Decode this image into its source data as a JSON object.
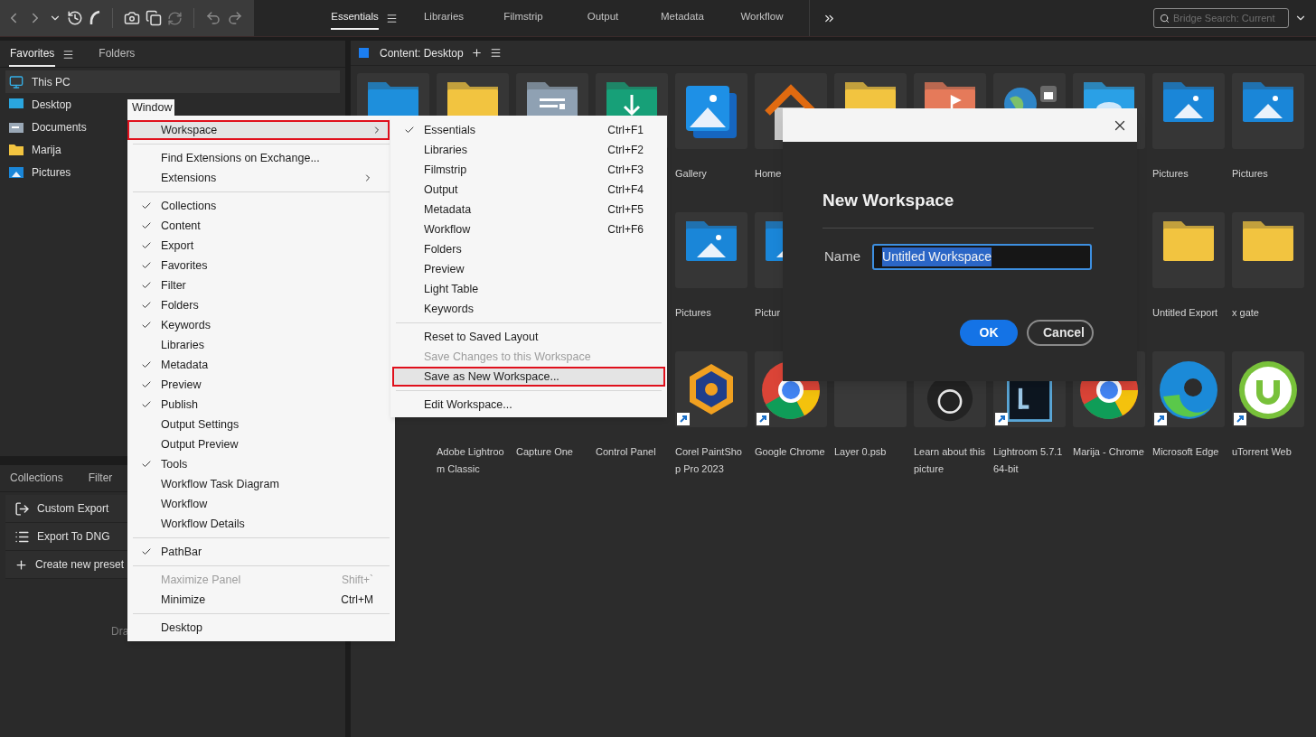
{
  "toolbar": {
    "search": {
      "placeholder": "Bridge Search: Current"
    }
  },
  "workspace_tabs": [
    {
      "label": "Essentials",
      "selected": true,
      "has_menu": true
    },
    {
      "label": "Libraries",
      "selected": false
    },
    {
      "label": "Filmstrip",
      "selected": false
    },
    {
      "label": "Output",
      "selected": false
    },
    {
      "label": "Metadata",
      "selected": false
    },
    {
      "label": "Workflow",
      "selected": false
    }
  ],
  "favorites_panel": {
    "tabs": [
      {
        "label": "Favorites",
        "selected": true,
        "has_menu": true
      },
      {
        "label": "Folders",
        "selected": false
      }
    ],
    "items": [
      {
        "label": "This PC",
        "kind": "pc",
        "selected": true
      },
      {
        "label": "Desktop",
        "kind": "desktop",
        "selected": false
      },
      {
        "label": "Documents",
        "kind": "documents",
        "selected": false
      },
      {
        "label": "Marija",
        "kind": "user-folder",
        "selected": false
      },
      {
        "label": "Pictures",
        "kind": "pictures",
        "selected": false
      }
    ]
  },
  "collections_panel": {
    "tabs": [
      {
        "label": "Collections",
        "selected": false
      },
      {
        "label": "Filter",
        "selected": false
      }
    ],
    "items": [
      {
        "label": "Custom Export",
        "kind": "export"
      },
      {
        "label": "Export To DNG",
        "kind": "list"
      },
      {
        "label": "Create new preset",
        "kind": "add"
      }
    ],
    "hint": "Dra"
  },
  "content": {
    "title": "Content: Desktop",
    "rows": [
      [
        {
          "kind": "folder",
          "color": "#1e8fdc"
        },
        {
          "kind": "folder",
          "color": "#f2c440"
        },
        {
          "kind": "documents-folder",
          "color": "#8fa1b3"
        },
        {
          "kind": "downloads-folder",
          "color": "#17a078"
        },
        {
          "kind": "gallery",
          "label": "Gallery"
        },
        {
          "kind": "home",
          "label": "Home"
        },
        {
          "kind": "folder",
          "color": "#f2c440"
        },
        {
          "kind": "music-folder",
          "color": "#e57a5a"
        },
        {
          "kind": "network"
        },
        {
          "kind": "cloud-folder",
          "color": "#2aa0e6"
        },
        {
          "kind": "pictures-folder",
          "label": "Pictures"
        },
        {
          "kind": "pictures-folder",
          "label": "Pictures"
        }
      ],
      [
        {
          "kind": "covered"
        },
        {
          "kind": "covered"
        },
        {
          "kind": "covered"
        },
        {
          "kind": "covered"
        },
        {
          "kind": "pictures-folder",
          "label": "Pictures"
        },
        {
          "kind": "pictures-folder",
          "label": "Pictur"
        },
        {
          "kind": "covered"
        },
        {
          "kind": "covered"
        },
        {
          "kind": "covered"
        },
        {
          "kind": "covered"
        },
        {
          "kind": "folder",
          "color": "#f2c440",
          "label": "Untitled Export"
        },
        {
          "kind": "folder",
          "color": "#f2c440",
          "label": "x gate"
        }
      ],
      [
        {
          "kind": "covered"
        },
        {
          "kind": "covered",
          "label": "Adobe Lightroom Classic"
        },
        {
          "kind": "covered",
          "label": "Capture One"
        },
        {
          "kind": "covered",
          "label": "Control Panel"
        },
        {
          "kind": "paint-app",
          "label": "Corel PaintShop Pro 2023",
          "shortcut": true
        },
        {
          "kind": "browser",
          "label": "Google Chrome",
          "shortcut": true
        },
        {
          "kind": "blank",
          "label": "Layer 0.psb"
        },
        {
          "kind": "dark-circle",
          "label": "Learn about this picture"
        },
        {
          "kind": "photo-app",
          "label": "Lightroom 5.7.1 64-bit",
          "shortcut": true
        },
        {
          "kind": "browser",
          "label": "Marija - Chrome"
        },
        {
          "kind": "edge-browser",
          "label": "Microsoft Edge",
          "shortcut": true
        },
        {
          "kind": "torrent-app",
          "label": "uTorrent Web",
          "shortcut": true
        }
      ]
    ]
  },
  "window_menu": {
    "title": "Window",
    "items": [
      {
        "kind": "item",
        "label": "Workspace",
        "submenu": true,
        "highlighted": true,
        "checked": false,
        "disabled": false
      },
      {
        "kind": "separator"
      },
      {
        "kind": "item",
        "label": "Find Extensions on Exchange...",
        "checked": false,
        "disabled": false
      },
      {
        "kind": "item",
        "label": "Extensions",
        "submenu": true,
        "checked": false,
        "disabled": false
      },
      {
        "kind": "separator"
      },
      {
        "kind": "item",
        "label": "Collections",
        "checked": true,
        "disabled": false
      },
      {
        "kind": "item",
        "label": "Content",
        "checked": true,
        "disabled": false
      },
      {
        "kind": "item",
        "label": "Export",
        "checked": true,
        "disabled": false
      },
      {
        "kind": "item",
        "label": "Favorites",
        "checked": true,
        "disabled": false
      },
      {
        "kind": "item",
        "label": "Filter",
        "checked": true,
        "disabled": false
      },
      {
        "kind": "item",
        "label": "Folders",
        "checked": true,
        "disabled": false
      },
      {
        "kind": "item",
        "label": "Keywords",
        "checked": true,
        "disabled": false
      },
      {
        "kind": "item",
        "label": "Libraries",
        "checked": false,
        "disabled": false
      },
      {
        "kind": "item",
        "label": "Metadata",
        "checked": true,
        "disabled": false
      },
      {
        "kind": "item",
        "label": "Preview",
        "checked": true,
        "disabled": false
      },
      {
        "kind": "item",
        "label": "Publish",
        "checked": true,
        "disabled": false
      },
      {
        "kind": "item",
        "label": "Output Settings",
        "checked": false,
        "disabled": false
      },
      {
        "kind": "item",
        "label": "Output Preview",
        "checked": false,
        "disabled": false
      },
      {
        "kind": "item",
        "label": "Tools",
        "checked": true,
        "disabled": false
      },
      {
        "kind": "item",
        "label": "Workflow Task Diagram",
        "checked": false,
        "disabled": false
      },
      {
        "kind": "item",
        "label": "Workflow",
        "checked": false,
        "disabled": false
      },
      {
        "kind": "item",
        "label": "Workflow Details",
        "checked": false,
        "disabled": false
      },
      {
        "kind": "separator"
      },
      {
        "kind": "item",
        "label": "PathBar",
        "checked": true,
        "disabled": false
      },
      {
        "kind": "separator"
      },
      {
        "kind": "item",
        "label": "Maximize Panel",
        "shortcut": "Shift+`",
        "checked": false,
        "disabled": true
      },
      {
        "kind": "item",
        "label": "Minimize",
        "shortcut": "Ctrl+M",
        "checked": false,
        "disabled": false
      },
      {
        "kind": "separator"
      },
      {
        "kind": "item",
        "label": "Desktop",
        "checked": false,
        "disabled": false
      }
    ]
  },
  "workspace_submenu": {
    "items": [
      {
        "kind": "item",
        "label": "Essentials",
        "shortcut": "Ctrl+F1",
        "checked": true,
        "disabled": false
      },
      {
        "kind": "item",
        "label": "Libraries",
        "shortcut": "Ctrl+F2",
        "checked": false,
        "disabled": false
      },
      {
        "kind": "item",
        "label": "Filmstrip",
        "shortcut": "Ctrl+F3",
        "checked": false,
        "disabled": false
      },
      {
        "kind": "item",
        "label": "Output",
        "shortcut": "Ctrl+F4",
        "checked": false,
        "disabled": false
      },
      {
        "kind": "item",
        "label": "Metadata",
        "shortcut": "Ctrl+F5",
        "checked": false,
        "disabled": false
      },
      {
        "kind": "item",
        "label": "Workflow",
        "shortcut": "Ctrl+F6",
        "checked": false,
        "disabled": false
      },
      {
        "kind": "item",
        "label": "Folders",
        "checked": false,
        "disabled": false
      },
      {
        "kind": "item",
        "label": "Preview",
        "checked": false,
        "disabled": false
      },
      {
        "kind": "item",
        "label": "Light Table",
        "checked": false,
        "disabled": false
      },
      {
        "kind": "item",
        "label": "Keywords",
        "checked": false,
        "disabled": false
      },
      {
        "kind": "separator"
      },
      {
        "kind": "item",
        "label": "Reset to Saved Layout",
        "checked": false,
        "disabled": false
      },
      {
        "kind": "item",
        "label": "Save Changes to this Workspace",
        "checked": false,
        "disabled": true
      },
      {
        "kind": "item",
        "label": "Save as New Workspace...",
        "highlighted": true,
        "checked": false,
        "disabled": false
      },
      {
        "kind": "separator"
      },
      {
        "kind": "item",
        "label": "Edit Workspace...",
        "checked": false,
        "disabled": false
      }
    ]
  },
  "dialog": {
    "title": "New Workspace",
    "field_label": "Name",
    "field_value": "Untitled Workspace",
    "text_selected": true,
    "buttons": [
      {
        "label": "OK",
        "kind": "primary"
      },
      {
        "label": "Cancel",
        "kind": "secondary"
      }
    ]
  }
}
